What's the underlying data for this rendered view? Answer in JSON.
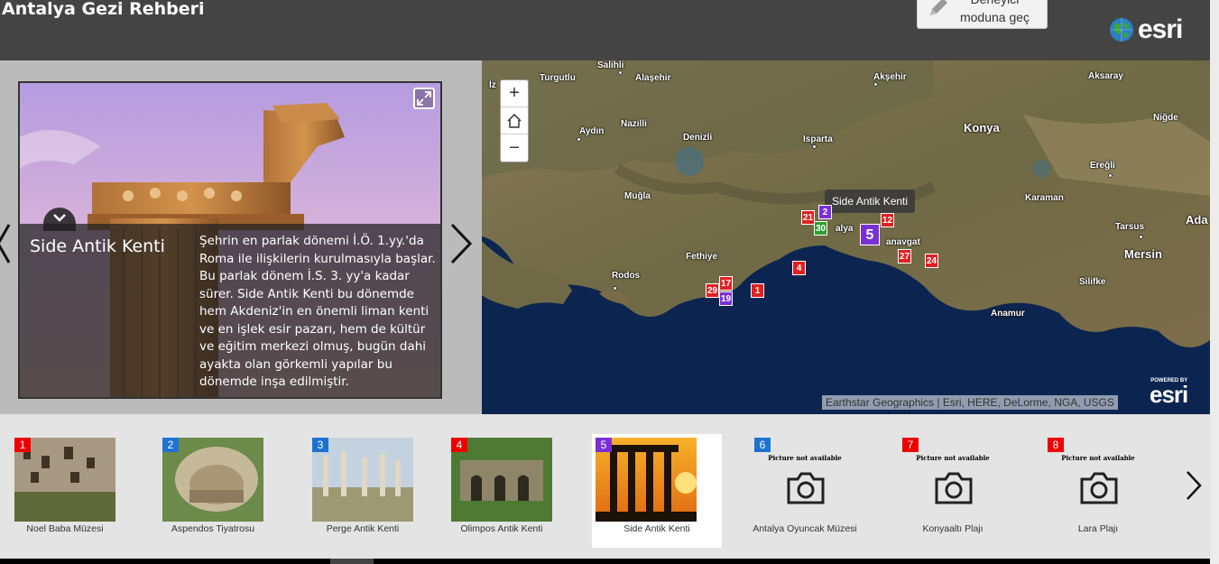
{
  "header": {
    "title": "Antalya Gezi Rehberi",
    "builder_button": "Derleyici moduna geç",
    "logo_text": "esri"
  },
  "story": {
    "title": "Side Antik Kenti",
    "description": "Şehrin en parlak dönemi İ.Ö. 1.yy.'da Roma ile ilişkilerin kurulmasıyla başlar. Bu parlak dönem İ.S. 3. yy'a kadar sürer. Side Antik Kenti bu dönemde hem Akdeniz'in en önemli liman kenti ve en işlek esir pazarı, hem de kültür ve eğitim merkezi olmuş, bugün dahi ayakta olan görkemli yapılar bu dönemde inşa edilmiştir."
  },
  "map": {
    "zoom_in": "+",
    "zoom_out": "−",
    "tooltip": "Side Antik Kenti",
    "attribution": "Earthstar Geographics | Esri, HERE, DeLorme, NGA, USGS",
    "powered_by": "POWERED BY",
    "powered_logo": "esri",
    "cities": [
      "Salihli",
      "Alaşehir",
      "Akşehir",
      "Aksaray",
      "Turgutlu",
      "Konya",
      "Niğde",
      "Nazilli",
      "Aydın",
      "Denizli",
      "Isparta",
      "Ereğli",
      "Muğla",
      "Karaman",
      "Tarsus",
      "Ada",
      "Fethiye",
      "Rodos",
      "Mersin",
      "Silifke",
      "Anamur",
      "İz",
      "alya",
      "anavgat"
    ],
    "markers": [
      "21",
      "2",
      "12",
      "30",
      "5",
      "4",
      "27",
      "24",
      "17",
      "29",
      "19",
      "1"
    ]
  },
  "places": [
    {
      "num": "1",
      "name": "Noel Baba Müzesi",
      "color": "red"
    },
    {
      "num": "2",
      "name": "Aspendos Tiyatrosu",
      "color": "blue"
    },
    {
      "num": "3",
      "name": "Perge Antik Kenti",
      "color": "blue"
    },
    {
      "num": "4",
      "name": "Olimpos Antik Kenti",
      "color": "red"
    },
    {
      "num": "5",
      "name": "Side Antik Kenti",
      "color": "purple"
    },
    {
      "num": "6",
      "name": "Antalya Oyuncak Müzesi",
      "color": "blue"
    },
    {
      "num": "7",
      "name": "Konyaaltı Plajı",
      "color": "red"
    },
    {
      "num": "8",
      "name": "Lara Plajı",
      "color": "red"
    }
  ],
  "placeholder_text": "Picture not available",
  "colors": {
    "header": "#444444",
    "red": "#e00000",
    "blue": "#1e73d2",
    "purple": "#7a2fd6"
  }
}
